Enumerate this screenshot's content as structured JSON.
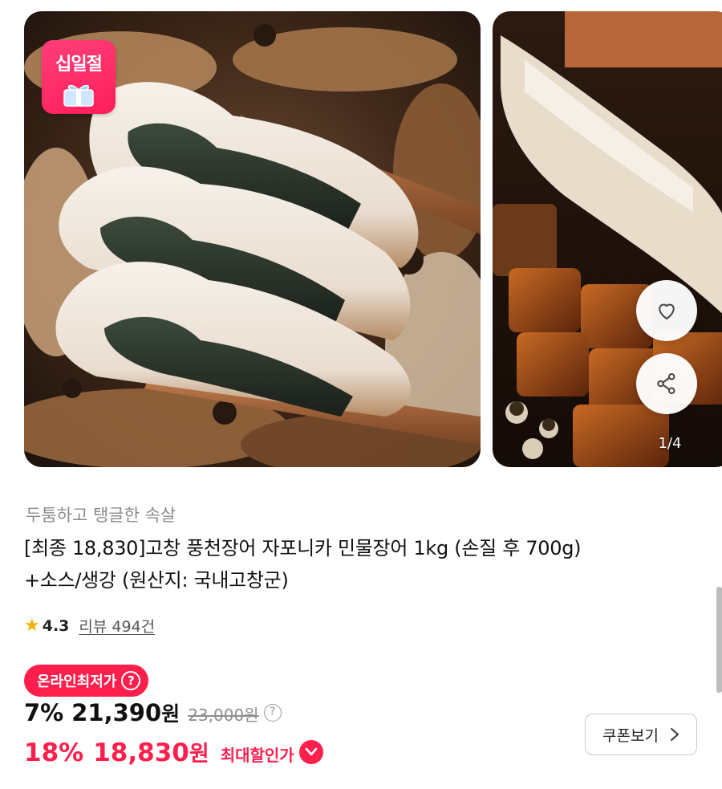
{
  "gallery": {
    "event_badge": "십일절",
    "counter": "1/4",
    "icons": [
      "heart-icon",
      "share-icon",
      "gift-icon"
    ]
  },
  "product": {
    "subtitle": "두툼하고 탱글한 속살",
    "title_line1": "[최종 18,830]고창 풍천장어 자포니카 민물장어 1kg (손질 후 700g)",
    "title_line2": "+소스/생강 (원산지: 국내고창군)"
  },
  "rating": {
    "score": "4.3",
    "review_label": "리뷰 494건"
  },
  "pricing": {
    "lowest_badge": "온라인최저가",
    "help_symbol": "?",
    "sale_rate": "7%",
    "sale_price": "21,390",
    "sale_won": "원",
    "original_price": "23,000원",
    "max_rate": "18%",
    "max_price": "18,830",
    "max_won": "원",
    "max_label": "최대할인가"
  },
  "coupon": {
    "label": "쿠폰보기"
  },
  "colors": {
    "accent": "#ff1f4d",
    "star": "#f6b100",
    "muted": "#8b8b8b"
  }
}
